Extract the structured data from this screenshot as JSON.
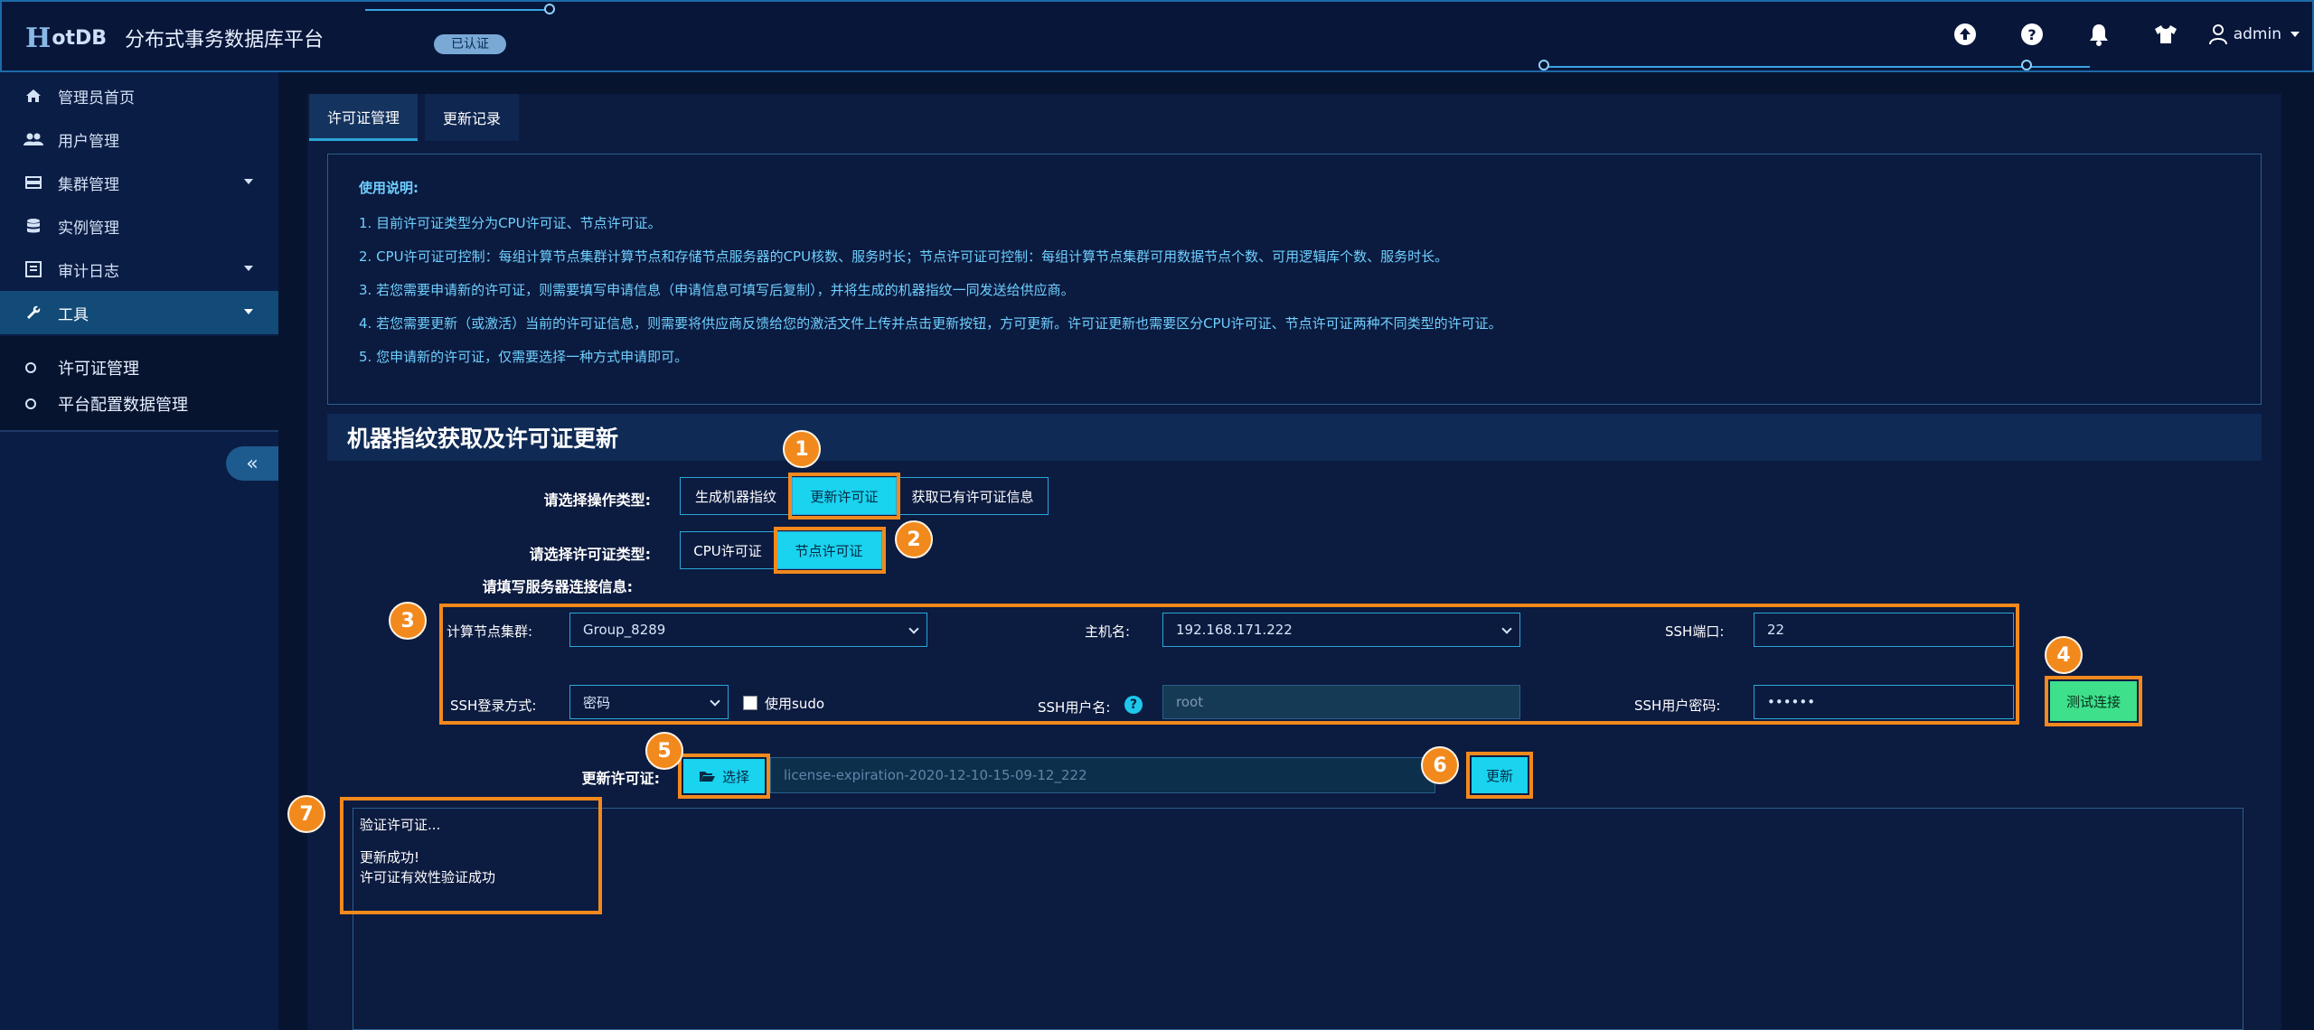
{
  "header": {
    "logo_mark": "H",
    "logo_text": "otDB",
    "title": "分布式事务数据库平台",
    "verified_badge": "已认证",
    "user": "admin",
    "icons": [
      "upload-icon",
      "help-icon",
      "bell-icon",
      "shirt-icon",
      "user-icon"
    ]
  },
  "sidebar": {
    "items": [
      {
        "label": "管理员首页",
        "icon": "home-icon"
      },
      {
        "label": "用户管理",
        "icon": "users-icon"
      },
      {
        "label": "集群管理",
        "icon": "cluster-icon"
      },
      {
        "label": "实例管理",
        "icon": "database-icon"
      },
      {
        "label": "审计日志",
        "icon": "audit-icon"
      },
      {
        "label": "工具",
        "icon": "wrench-icon"
      }
    ],
    "subitems": [
      {
        "label": "许可证管理"
      },
      {
        "label": "平台配置数据管理"
      }
    ],
    "collapse_label": "«"
  },
  "tabs": [
    {
      "label": "许可证管理",
      "active": true
    },
    {
      "label": "更新记录",
      "active": false
    }
  ],
  "notes": {
    "title": "使用说明:",
    "lines": [
      "1. 目前许可证类型分为CPU许可证、节点许可证。",
      "2. CPU许可证可控制：每组计算节点集群计算节点和存储节点服务器的CPU核数、服务时长；节点许可证可控制：每组计算节点集群可用数据节点个数、可用逻辑库个数、服务时长。",
      "3. 若您需要申请新的许可证，则需要填写申请信息（申请信息可填写后复制），并将生成的机器指纹一同发送给供应商。",
      "4. 若您需要更新（或激活）当前的许可证信息，则需要将供应商反馈给您的激活文件上传并点击更新按钮，方可更新。许可证更新也需要区分CPU许可证、节点许可证两种不同类型的许可证。",
      "5. 您申请新的许可证，仅需要选择一种方式申请即可。"
    ]
  },
  "section": {
    "title": "机器指纹获取及许可证更新"
  },
  "form": {
    "operation_label": "请选择操作类型:",
    "operations": [
      "生成机器指纹",
      "更新许可证",
      "获取已有许可证信息"
    ],
    "operation_selected": "更新许可证",
    "license_type_label": "请选择许可证类型:",
    "license_types": [
      "CPU许可证",
      "节点许可证"
    ],
    "license_type_selected": "节点许可证",
    "server_info_label": "请填写服务器连接信息:",
    "cluster_label": "计算节点集群:",
    "cluster_value": "Group_8289",
    "host_label": "主机名:",
    "host_value": "192.168.171.222",
    "ssh_port_label": "SSH端口:",
    "ssh_port_value": "22",
    "ssh_login_label": "SSH登录方式:",
    "ssh_login_value": "密码",
    "sudo_label": "使用sudo",
    "ssh_user_label": "SSH用户名:",
    "ssh_user_value": "root",
    "ssh_password_label": "SSH用户密码:",
    "ssh_password_value": "••••••",
    "test_button": "测试连接",
    "update_license_label": "更新许可证:",
    "choose_button": "选择",
    "file_name": "license-expiration-2020-12-10-15-09-12_222",
    "update_button": "更新"
  },
  "log": {
    "lines": [
      "验证许可证...",
      "更新成功!",
      "许可证有效性验证成功"
    ]
  },
  "callouts": [
    "1",
    "2",
    "3",
    "4",
    "5",
    "6",
    "7"
  ],
  "colors": {
    "accent": "#19d3ef",
    "highlight": "#f2891d",
    "success": "#3ee08c",
    "background": "#071430"
  }
}
